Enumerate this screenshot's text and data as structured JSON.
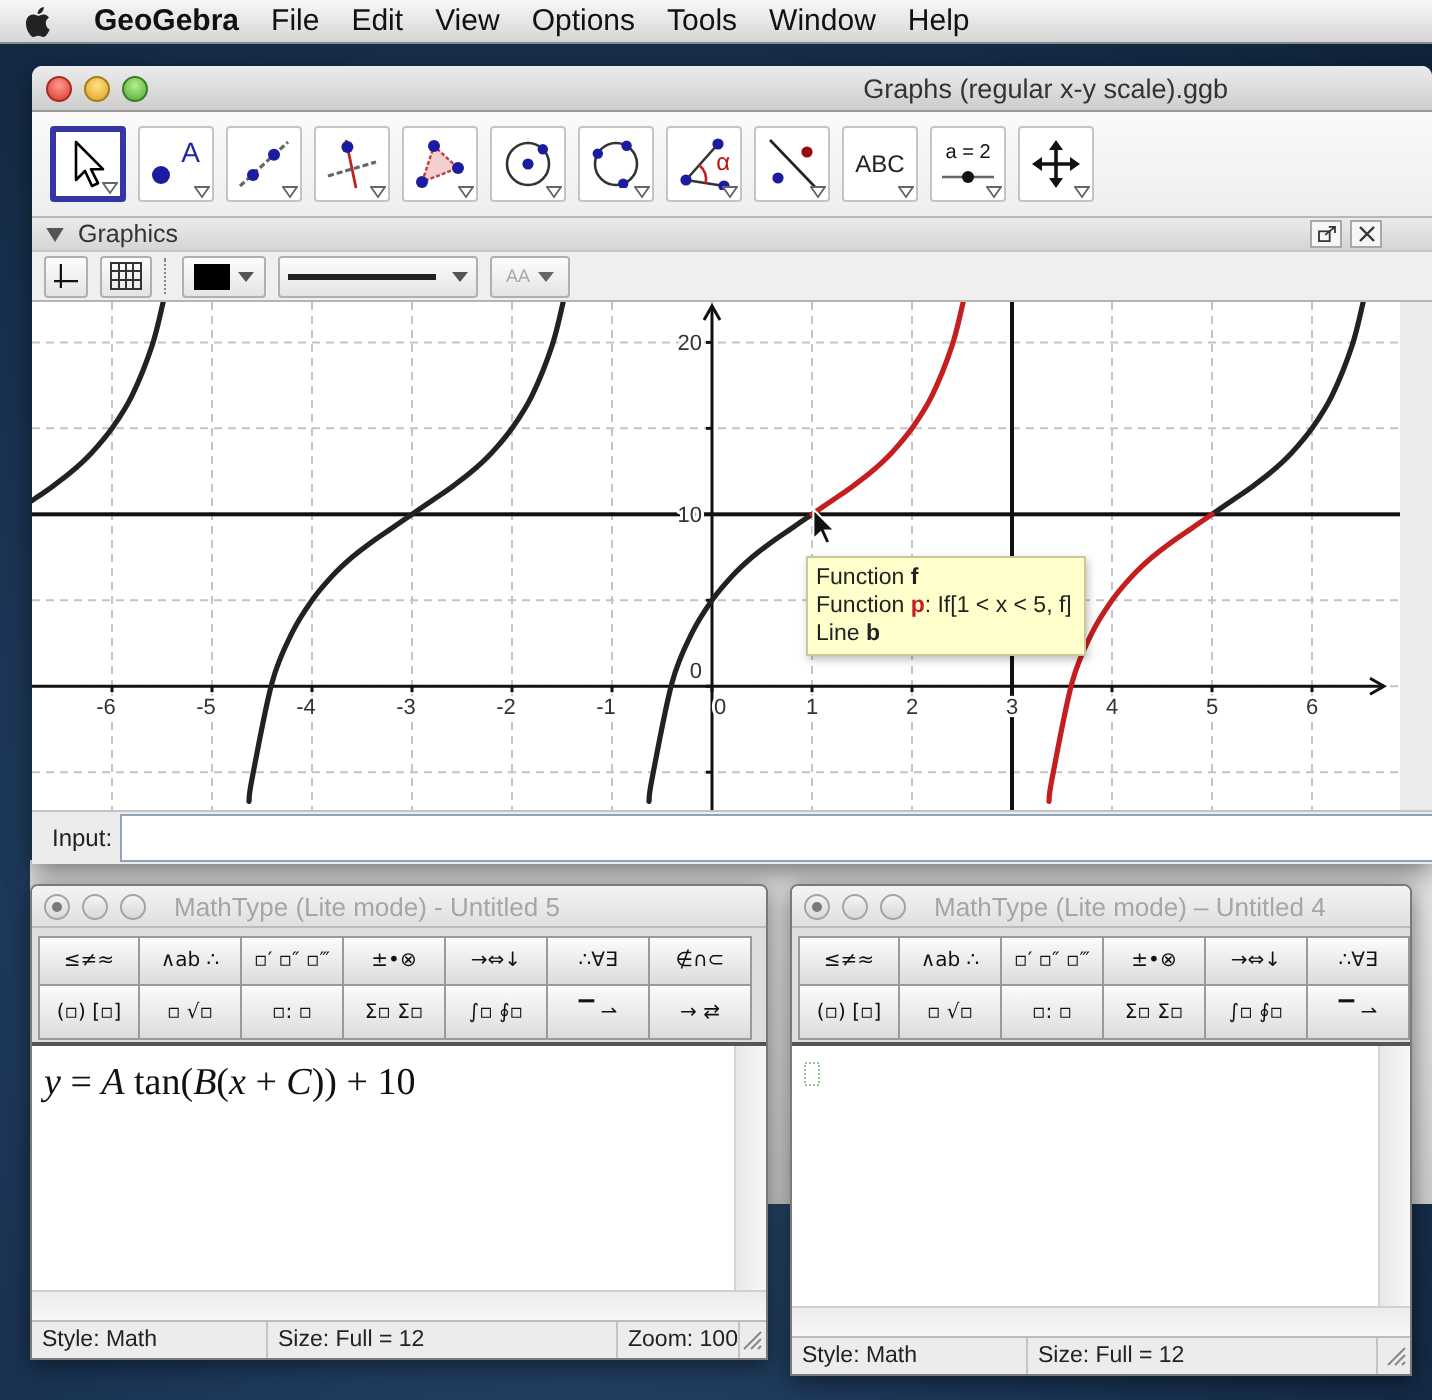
{
  "menu_bar": {
    "app_name": "GeoGebra",
    "items": [
      "File",
      "Edit",
      "View",
      "Options",
      "Tools",
      "Window",
      "Help"
    ]
  },
  "geogebra_window": {
    "title": "Graphs (regular x-y scale).ggb",
    "active": true,
    "toolbar": [
      {
        "kind": "move",
        "selected": true
      },
      {
        "kind": "point",
        "label": "A",
        "selected": false
      },
      {
        "kind": "line",
        "selected": false
      },
      {
        "kind": "perpendicular",
        "selected": false
      },
      {
        "kind": "polygon",
        "selected": false
      },
      {
        "kind": "circle_center",
        "selected": false
      },
      {
        "kind": "circle_three_points",
        "selected": false
      },
      {
        "kind": "angle",
        "label": "α",
        "selected": false
      },
      {
        "kind": "reflect",
        "selected": false
      },
      {
        "kind": "text",
        "label": "ABC",
        "selected": false
      },
      {
        "kind": "slider",
        "label": "a = 2",
        "selected": false
      },
      {
        "kind": "move_view",
        "selected": false
      }
    ],
    "graphics_panel": {
      "title": "Graphics",
      "expanded": true,
      "style_bar": {
        "color": "#000000",
        "font_button": {
          "label": "AA",
          "disabled": true
        }
      },
      "chart_data": {
        "type": "line",
        "grid": true,
        "xlim": [
          -6.8,
          6.88
        ],
        "ylim": [
          -7.2,
          22.35
        ],
        "xticks": [
          -6,
          -5,
          -4,
          -3,
          -2,
          -1,
          0,
          1,
          2,
          3,
          4,
          5,
          6
        ],
        "yticks": [
          0,
          10,
          20
        ],
        "x": [
          -6.8,
          -6.6,
          -6.4,
          -6.2,
          -6,
          -5.8,
          -5.6,
          -5.49,
          -4.63,
          -4.6,
          -4.4,
          -4.2,
          -4,
          -3.8,
          -3.6,
          -3.4,
          -3.2,
          -3,
          -2.8,
          -2.6,
          -2.4,
          -2.2,
          -2,
          -1.8,
          -1.6,
          -1.49,
          -0.63,
          -0.6,
          -0.4,
          -0.2,
          0,
          0.2,
          0.4,
          0.6,
          0.8,
          1,
          1.2,
          1.4,
          1.6,
          1.8,
          2,
          2.2,
          2.4,
          2.51,
          3.37,
          3.4,
          3.6,
          3.8,
          4,
          4.2,
          4.4,
          4.6,
          4.8,
          5,
          5.2,
          5.4,
          5.6,
          5.8,
          6,
          6.2,
          6.4,
          6.51
        ],
        "series": [
          {
            "color": "#222222",
            "values": [
              10.8,
              11.6,
              12.5,
              13.6,
              15,
              16.9,
              19.8,
              22.3,
              null,
              null,
              null,
              null,
              null,
              null,
              null,
              null,
              null,
              null,
              null,
              null,
              null,
              null,
              null,
              null,
              null,
              null,
              null,
              null,
              null,
              null,
              null,
              null,
              null,
              null,
              null,
              null,
              null,
              null,
              null,
              null,
              null,
              null,
              null,
              null,
              null,
              null,
              null,
              null,
              null,
              null,
              null,
              null,
              null,
              null,
              null,
              null,
              null,
              null,
              null,
              null,
              null,
              null
            ]
          },
          {
            "color": "#222222",
            "values": [
              null,
              null,
              null,
              null,
              null,
              null,
              null,
              null,
              -6.7,
              -5.4,
              0.2,
              3.1,
              5,
              6.4,
              7.5,
              8.4,
              9.2,
              10,
              10.8,
              11.6,
              12.5,
              13.6,
              15,
              16.9,
              19.8,
              22.3,
              null,
              null,
              null,
              null,
              null,
              null,
              null,
              null,
              null,
              null,
              null,
              null,
              null,
              null,
              null,
              null,
              null,
              null,
              null,
              null,
              null,
              null,
              null,
              null,
              null,
              null,
              null,
              null,
              null,
              null,
              null,
              null,
              null,
              null,
              null,
              null
            ]
          },
          {
            "color": "#222222",
            "values": [
              null,
              null,
              null,
              null,
              null,
              null,
              null,
              null,
              null,
              null,
              null,
              null,
              null,
              null,
              null,
              null,
              null,
              null,
              null,
              null,
              null,
              null,
              null,
              null,
              null,
              null,
              -6.7,
              -5.4,
              0.2,
              3.1,
              5,
              6.4,
              7.5,
              8.4,
              9.2,
              10,
              null,
              null,
              null,
              null,
              null,
              null,
              null,
              null,
              null,
              null,
              null,
              null,
              null,
              null,
              null,
              null,
              null,
              null,
              null,
              null,
              null,
              null,
              null,
              null,
              null,
              null
            ]
          },
          {
            "color": "#222222",
            "values": [
              null,
              null,
              null,
              null,
              null,
              null,
              null,
              null,
              null,
              null,
              null,
              null,
              null,
              null,
              null,
              null,
              null,
              null,
              null,
              null,
              null,
              null,
              null,
              null,
              null,
              null,
              null,
              null,
              null,
              null,
              null,
              null,
              null,
              null,
              null,
              null,
              null,
              null,
              null,
              null,
              null,
              null,
              null,
              null,
              null,
              null,
              null,
              null,
              null,
              null,
              null,
              null,
              null,
              10,
              10.8,
              11.6,
              12.5,
              13.6,
              15,
              16.9,
              19.8,
              22.3
            ]
          },
          {
            "color": "#c41e1e",
            "values": [
              null,
              null,
              null,
              null,
              null,
              null,
              null,
              null,
              null,
              null,
              null,
              null,
              null,
              null,
              null,
              null,
              null,
              null,
              null,
              null,
              null,
              null,
              null,
              null,
              null,
              null,
              null,
              null,
              null,
              null,
              null,
              null,
              null,
              null,
              null,
              10,
              10.8,
              11.6,
              12.5,
              13.6,
              15,
              16.9,
              19.8,
              22.3,
              null,
              null,
              null,
              null,
              null,
              null,
              null,
              null,
              null,
              null,
              null,
              null,
              null,
              null,
              null,
              null,
              null,
              null
            ]
          },
          {
            "color": "#c41e1e",
            "values": [
              null,
              null,
              null,
              null,
              null,
              null,
              null,
              null,
              null,
              null,
              null,
              null,
              null,
              null,
              null,
              null,
              null,
              null,
              null,
              null,
              null,
              null,
              null,
              null,
              null,
              null,
              null,
              null,
              null,
              null,
              null,
              null,
              null,
              null,
              null,
              null,
              null,
              null,
              null,
              null,
              null,
              null,
              null,
              null,
              -6.7,
              -5.4,
              0.2,
              3.1,
              5,
              6.4,
              7.5,
              8.4,
              9.2,
              10,
              null,
              null,
              null,
              null,
              null,
              null,
              null,
              null
            ]
          }
        ],
        "ref_lines": [
          {
            "axis": "x",
            "value": 3
          },
          {
            "axis": "y",
            "value": 10
          }
        ]
      },
      "tooltip": [
        {
          "text": "Function **f**",
          "color": "#222222"
        },
        {
          "text": "Function **p**: If[1 < x < 5, f]",
          "color": "#c41e1e"
        },
        {
          "text": "Line **b**",
          "color": "#222222"
        }
      ]
    },
    "input_bar": {
      "label": "Input:"
    }
  },
  "mathtype_windows": [
    {
      "title": "MathType (Lite mode) - Untitled 5",
      "active": false,
      "unsaved": true,
      "palette": [
        [
          "≤≠≈",
          "∧ab ∴",
          "▫′ ▫″ ▫‴",
          "±•⊗",
          "→⇔↓",
          "∴∀∃",
          "∉∩⊂"
        ],
        [
          "(▫) [▫]",
          "▫ √▫",
          "▫: ▫",
          "Σ▫ Σ▫",
          "∫▫ ∮▫",
          "▔ ⇀",
          "→ ⇄"
        ]
      ],
      "equation": "*y* = *A* tan(*B*(*x* + *C*)) + 10",
      "status": [
        "Style: Math",
        "Size: Full = 12",
        "Zoom: 100"
      ]
    },
    {
      "title": "MathType (Lite mode) – Untitled 4",
      "active": false,
      "unsaved": true,
      "palette": [
        [
          "≤≠≈",
          "∧ab ∴",
          "▫′ ▫″ ▫‴",
          "±•⊗",
          "→⇔↓",
          "∴∀∃"
        ],
        [
          "(▫) [▫]",
          "▫ √▫",
          "▫: ▫",
          "Σ▫ Σ▫",
          "∫▫ ∮▫",
          "▔ ⇀"
        ]
      ],
      "status": [
        "Style: Math",
        "Size: Full = 12"
      ]
    }
  ]
}
